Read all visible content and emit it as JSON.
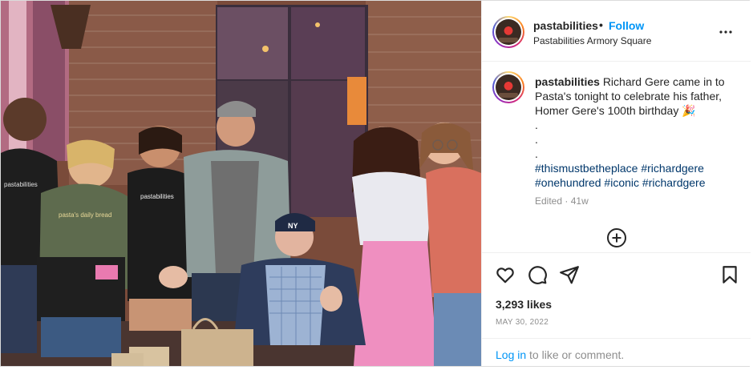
{
  "post": {
    "username": "pastabilities",
    "separator": "•",
    "follow_label": "Follow",
    "location": "Pastabilities Armory Square",
    "more_icon": "more-horizontal-icon"
  },
  "photo": {
    "description_icon": "post-photo",
    "shirt_text": "pastabilities",
    "cap_logo": "NY"
  },
  "caption": {
    "username": "pastabilities",
    "text": "Richard Gere came in to Pasta's tonight to celebrate his father, Homer Gere's 100th birthday 🎉",
    "dots": [
      ".",
      ".",
      "."
    ],
    "hashtags": [
      "#thismustbetheplace",
      "#richardgere",
      "#onehundred",
      "#iconic",
      "#richardgere"
    ],
    "edited": "Edited",
    "age_sep": "·",
    "age": "41w"
  },
  "actions": {
    "like_icon": "heart-icon",
    "comment_icon": "comment-icon",
    "share_icon": "share-icon",
    "save_icon": "bookmark-icon",
    "load_more_icon": "plus-circle-icon"
  },
  "likes": "3,293 likes",
  "date": "MAY 30, 2022",
  "login": {
    "link": "Log in",
    "text": " to like or comment."
  },
  "colors": {
    "link_blue": "#0095f6",
    "hashtag_blue": "#00376b",
    "muted": "#8e8e8e",
    "border": "#dbdbdb"
  }
}
